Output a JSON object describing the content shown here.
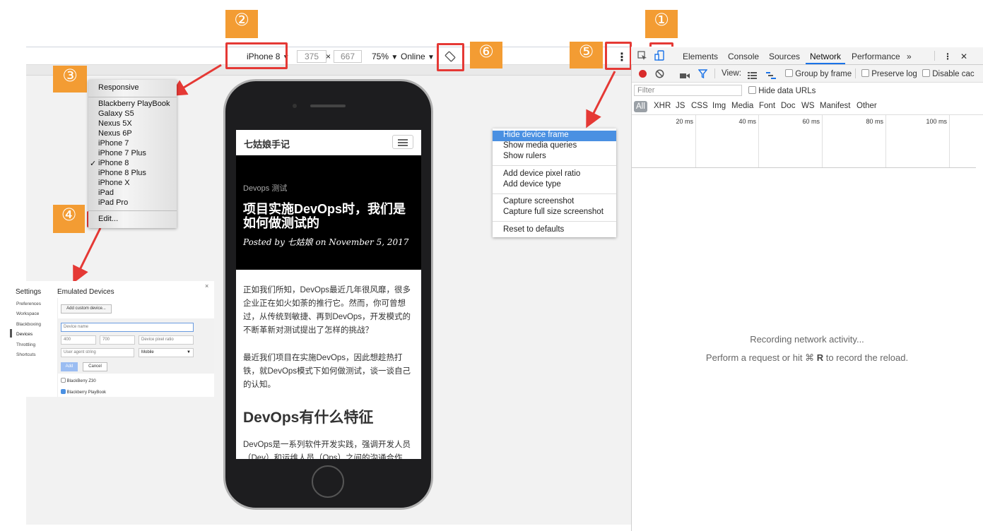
{
  "badges": [
    "①",
    "②",
    "③",
    "④",
    "⑤",
    "⑥"
  ],
  "toolbar": {
    "device": "iPhone 8",
    "width": "375",
    "times": "×",
    "height": "667",
    "zoom": "75%",
    "network": "Online",
    "caret": "▼",
    "more": "⋮"
  },
  "device_dropdown": {
    "responsive": "Responsive",
    "devices": [
      "Blackberry PlayBook",
      "Galaxy S5",
      "Nexus 5X",
      "Nexus 6P",
      "iPhone 7",
      "iPhone 7 Plus",
      "iPhone 8",
      "iPhone 8 Plus",
      "iPhone X",
      "iPad",
      "iPad Pro"
    ],
    "checkmark": "✓",
    "edit": "Edit..."
  },
  "phone": {
    "site_title": "七姑娘手记",
    "tag": "Devops 测试",
    "post_title": "项目实施DevOps时，我们是如何做测试的",
    "meta": "Posted by 七姑娘 on November 5, 2017",
    "p1": "正如我们所知，DevOps最近几年很风靡，很多企业正在如火如荼的推行它。然而，你可曾想过，从传统到敏捷、再到DevOps，开发模式的不断革新对测试提出了怎样的挑战？",
    "p2": "最近我们项目在实施DevOps，因此想趁热打铁，就DevOps模式下如何做测试，谈一谈自己的认知。",
    "h2": "DevOps有什么特征",
    "p3": "DevOps是一系列软件开发实践，强调开发人员（Dev）和运维人员（Ops）之间的沟通合作"
  },
  "more_menu": {
    "items": [
      "Hide device frame",
      "Show media queries",
      "Show rulers",
      "Add device pixel ratio",
      "Add device type",
      "Capture screenshot",
      "Capture full size screenshot",
      "Reset to defaults"
    ]
  },
  "settings": {
    "title": "Settings",
    "nav": [
      "Preferences",
      "Workspace",
      "Blackboxing",
      "Devices",
      "Throttling",
      "Shortcuts"
    ],
    "heading": "Emulated Devices",
    "close": "×",
    "add_custom": "Add custom device...",
    "device_name": "Device name",
    "w": "400",
    "h": "700",
    "dpr": "Device pixel ratio",
    "ua": "User agent string",
    "ua_type": "Mobile",
    "add": "Add",
    "cancel": "Cancel",
    "list": [
      "BlackBerry Z30",
      "Blackberry PlayBook"
    ]
  },
  "devtools": {
    "tabs": [
      "Elements",
      "Console",
      "Sources",
      "Network",
      "Performance"
    ],
    "overflow": "»",
    "more": "⋮",
    "close": "✕",
    "view": "View:",
    "group_by_frame": "Group by frame",
    "preserve_log": "Preserve log",
    "disable_cache": "Disable cac",
    "filter_placeholder": "Filter",
    "hide_data_urls": "Hide data URLs",
    "types": [
      "All",
      "XHR",
      "JS",
      "CSS",
      "Img",
      "Media",
      "Font",
      "Doc",
      "WS",
      "Manifest",
      "Other"
    ],
    "timeline": [
      "20 ms",
      "40 ms",
      "60 ms",
      "80 ms",
      "100 ms"
    ],
    "msg1": "Recording network activity...",
    "msg2_pre": "Perform a request or hit ⌘ ",
    "msg2_key": "R",
    "msg2_post": " to record the reload."
  }
}
